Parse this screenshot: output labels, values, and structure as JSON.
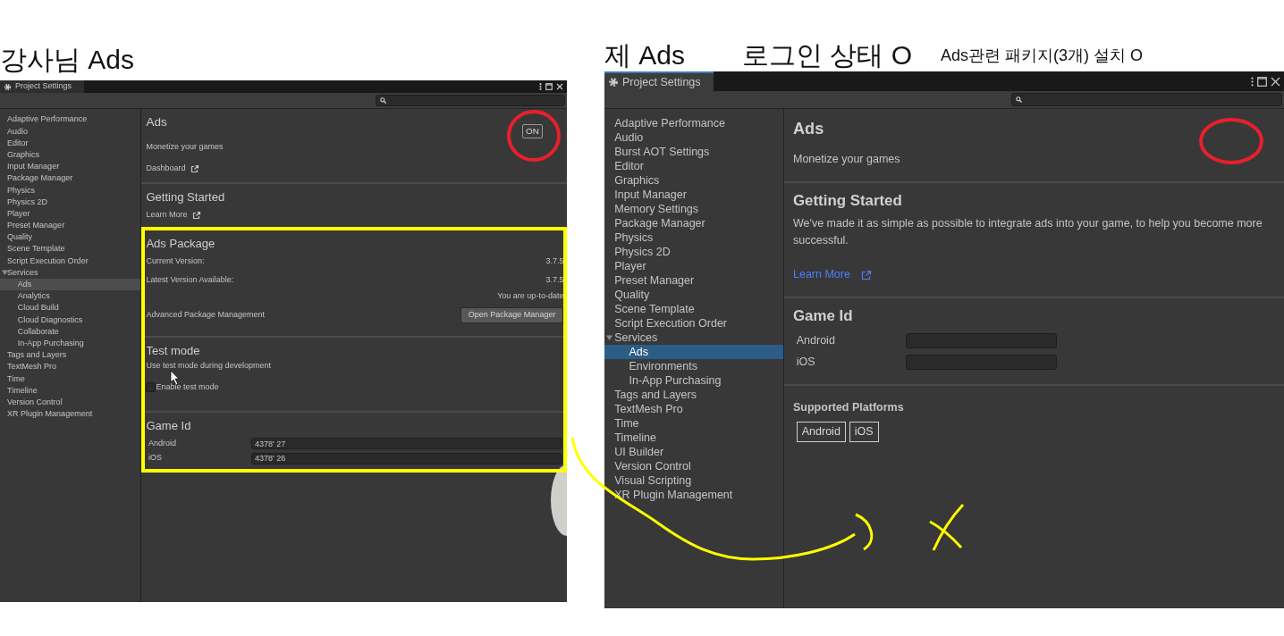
{
  "left_caption": "강사님 Ads",
  "right_captions": [
    "제 Ads",
    "로그인 상태 O",
    "Ads관련 패키지(3개) 설치 O"
  ],
  "left_window": {
    "tab": "Project Settings",
    "sidebar": [
      {
        "label": "Adaptive Performance",
        "selected": false
      },
      {
        "label": "Audio",
        "selected": false
      },
      {
        "label": "Editor",
        "selected": false
      },
      {
        "label": "Graphics",
        "selected": false
      },
      {
        "label": "Input Manager",
        "selected": false
      },
      {
        "label": "Package Manager",
        "selected": false
      },
      {
        "label": "Physics",
        "selected": false
      },
      {
        "label": "Physics 2D",
        "selected": false
      },
      {
        "label": "Player",
        "selected": false
      },
      {
        "label": "Preset Manager",
        "selected": false
      },
      {
        "label": "Quality",
        "selected": false
      },
      {
        "label": "Scene Template",
        "selected": false
      },
      {
        "label": "Script Execution Order",
        "selected": false
      },
      {
        "label": "Services",
        "selected": false,
        "expanded": true,
        "children": [
          {
            "label": "Ads",
            "selected": true
          },
          {
            "label": "Analytics",
            "selected": false
          },
          {
            "label": "Cloud Build",
            "selected": false
          },
          {
            "label": "Cloud Diagnostics",
            "selected": false
          },
          {
            "label": "Collaborate",
            "selected": false
          },
          {
            "label": "In-App Purchasing",
            "selected": false
          }
        ]
      },
      {
        "label": "Tags and Layers",
        "selected": false
      },
      {
        "label": "TextMesh Pro",
        "selected": false
      },
      {
        "label": "Time",
        "selected": false
      },
      {
        "label": "Timeline",
        "selected": false
      },
      {
        "label": "Version Control",
        "selected": false
      },
      {
        "label": "XR Plugin Management",
        "selected": false
      }
    ],
    "header": {
      "title": "Ads",
      "subtitle": "Monetize your games",
      "link": "Dashboard",
      "toggle": "ON"
    },
    "getting_started": {
      "title": "Getting Started",
      "link": "Learn More"
    },
    "package": {
      "title": "Ads Package",
      "rows": [
        {
          "label": "Current Version:",
          "value": "3.7.5"
        },
        {
          "label": "Latest Version Available:",
          "value": "3.7.5"
        }
      ],
      "status": "You are up-to-date",
      "advanced_label": "Advanced Package Management",
      "button": "Open Package Manager"
    },
    "test_mode": {
      "title": "Test mode",
      "description": "Use test mode during development",
      "checkbox": {
        "label": "Enable test mode",
        "checked": false
      }
    },
    "game_id": {
      "title": "Game Id",
      "fields": [
        {
          "label": "Android",
          "value": "4378' 27"
        },
        {
          "label": "iOS",
          "value": "4378' 26"
        }
      ]
    }
  },
  "right_window": {
    "tab": "Project Settings",
    "sidebar": [
      {
        "label": "Adaptive Performance",
        "selected": false
      },
      {
        "label": "Audio",
        "selected": false
      },
      {
        "label": "Burst AOT Settings",
        "selected": false
      },
      {
        "label": "Editor",
        "selected": false
      },
      {
        "label": "Graphics",
        "selected": false
      },
      {
        "label": "Input Manager",
        "selected": false
      },
      {
        "label": "Memory Settings",
        "selected": false
      },
      {
        "label": "Package Manager",
        "selected": false
      },
      {
        "label": "Physics",
        "selected": false
      },
      {
        "label": "Physics 2D",
        "selected": false
      },
      {
        "label": "Player",
        "selected": false
      },
      {
        "label": "Preset Manager",
        "selected": false
      },
      {
        "label": "Quality",
        "selected": false
      },
      {
        "label": "Scene Template",
        "selected": false
      },
      {
        "label": "Script Execution Order",
        "selected": false
      },
      {
        "label": "Services",
        "selected": false,
        "expanded": true,
        "children": [
          {
            "label": "Ads",
            "selected": true
          },
          {
            "label": "Environments",
            "selected": false
          },
          {
            "label": "In-App Purchasing",
            "selected": false
          }
        ]
      },
      {
        "label": "Tags and Layers",
        "selected": false
      },
      {
        "label": "TextMesh Pro",
        "selected": false
      },
      {
        "label": "Time",
        "selected": false
      },
      {
        "label": "Timeline",
        "selected": false
      },
      {
        "label": "UI Builder",
        "selected": false
      },
      {
        "label": "Version Control",
        "selected": false
      },
      {
        "label": "Visual Scripting",
        "selected": false
      },
      {
        "label": "XR Plugin Management",
        "selected": false
      }
    ],
    "header": {
      "title": "Ads",
      "subtitle": "Monetize your games"
    },
    "getting_started": {
      "title": "Getting Started",
      "description": "We've made it as simple as possible to integrate ads into your game, to help you become more successful.",
      "link": "Learn More"
    },
    "game_id": {
      "title": "Game Id",
      "fields": [
        {
          "label": "Android"
        },
        {
          "label": "iOS"
        }
      ]
    },
    "supported_platforms": {
      "title": "Supported Platforms",
      "tags": [
        "Android",
        "iOS"
      ]
    }
  }
}
